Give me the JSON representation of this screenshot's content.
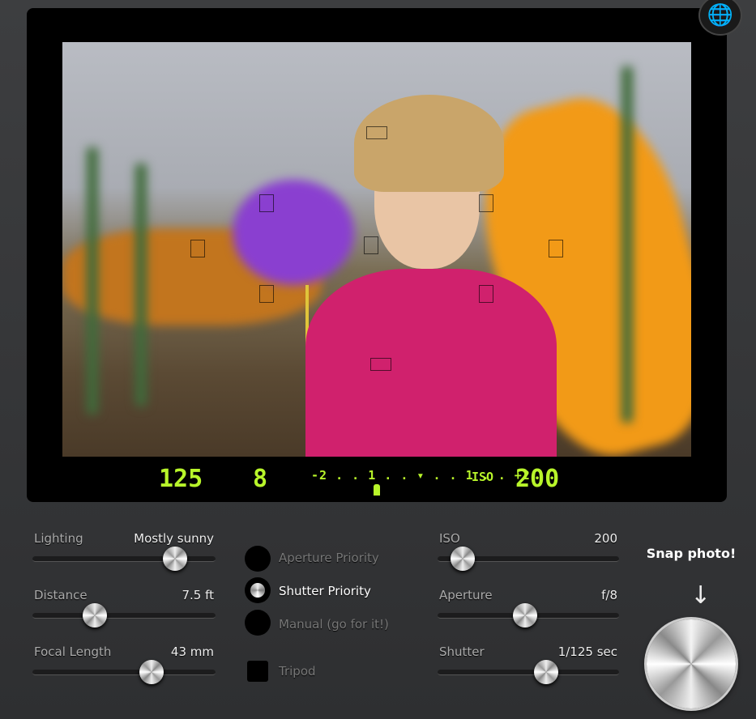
{
  "viewfinder": {
    "shutter": "125",
    "aperture": "8",
    "meter_scale": "-2 . . 1 . . ▾ . . 1 . . +2",
    "iso_label": "ISO",
    "iso": "200"
  },
  "globe_icon": "globe-icon",
  "sliders": [
    {
      "label": "Lighting",
      "value": "Mostly sunny",
      "level": 0.78
    },
    {
      "label": "Distance",
      "value": "7.5 ft",
      "level": 0.34
    },
    {
      "label": "Focal Length",
      "value": "43 mm",
      "level": 0.65
    },
    {
      "label": "ISO",
      "value": "200",
      "level": 0.14
    },
    {
      "label": "Aperture",
      "value": "f/8",
      "level": 0.48
    },
    {
      "label": "Shutter",
      "value": "1/125 sec",
      "level": 0.6
    }
  ],
  "modes": [
    {
      "label": "Aperture Priority",
      "selected": false
    },
    {
      "label": "Shutter Priority",
      "selected": true
    },
    {
      "label": "Manual (go for it!)",
      "selected": false
    }
  ],
  "tripod": {
    "label": "Tripod",
    "checked": false
  },
  "snap": {
    "label": "Snap photo!",
    "arrow": "↓"
  }
}
